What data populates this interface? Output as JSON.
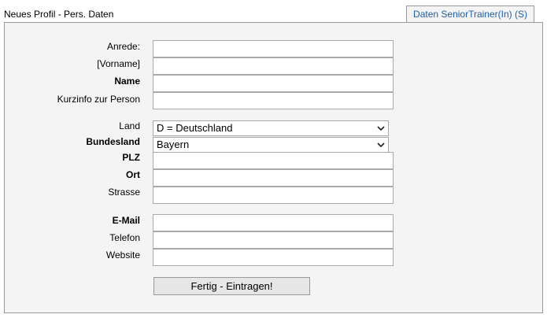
{
  "header": {
    "title": "Neues Profil - Pers. Daten",
    "tab_label": "Daten SeniorTrainer(In) (S)"
  },
  "form": {
    "anrede": {
      "label": "Anrede:",
      "value": ""
    },
    "vorname": {
      "label": "[Vorname]",
      "value": ""
    },
    "name": {
      "label": "Name",
      "value": ""
    },
    "kurzinfo": {
      "label": "Kurzinfo zur Person",
      "value": ""
    },
    "land": {
      "label": "Land",
      "selected": "D = Deutschland"
    },
    "bundesland": {
      "label": "Bundesland",
      "selected": "Bayern"
    },
    "plz": {
      "label": "PLZ",
      "value": ""
    },
    "ort": {
      "label": "Ort",
      "value": ""
    },
    "strasse": {
      "label": "Strasse",
      "value": ""
    },
    "email": {
      "label": "E-Mail",
      "value": ""
    },
    "telefon": {
      "label": "Telefon",
      "value": ""
    },
    "website": {
      "label": "Website",
      "value": ""
    },
    "submit_label": "Fertig - Eintragen!"
  },
  "icons": {
    "dropdown": "chevron-down-icon"
  },
  "colors": {
    "tab_text": "#1f5fb0",
    "panel_bg": "#f4f4f4",
    "border": "#9a9a9a"
  }
}
